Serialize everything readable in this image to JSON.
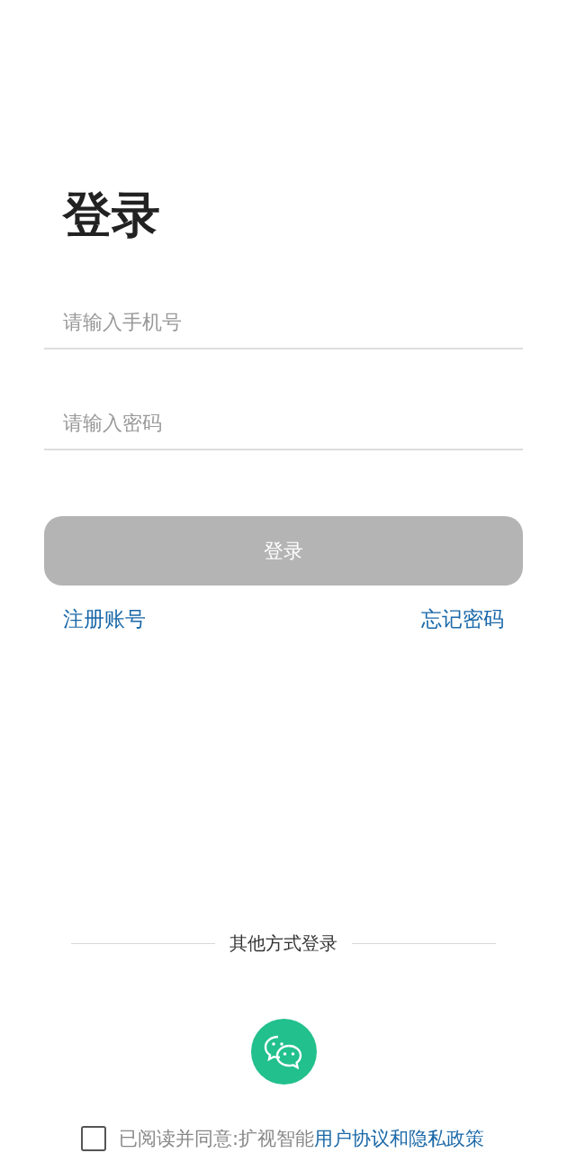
{
  "title": "登录",
  "fields": [
    {
      "placeholder": "请输入手机号"
    },
    {
      "placeholder": "请输入密码"
    }
  ],
  "login_button": {
    "label": "登录",
    "disabled": true
  },
  "links": {
    "register": "注册账号",
    "forgot": "忘记密码"
  },
  "other_login": {
    "label": "其他方式登录"
  },
  "agreement": {
    "checked": false,
    "text": "已阅读并同意:扩视智能",
    "link_1": "用户协议",
    "joiner": "和",
    "link_2": "隐私政策"
  }
}
